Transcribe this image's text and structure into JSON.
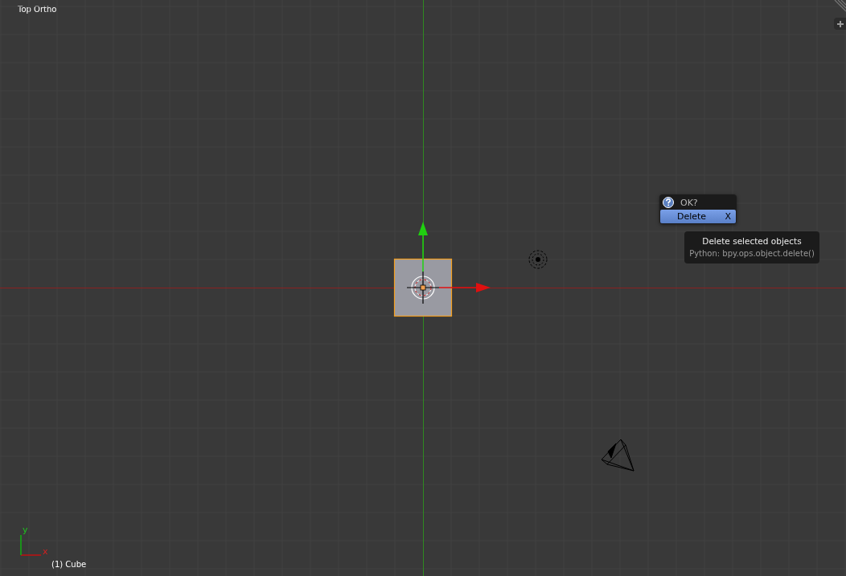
{
  "viewport": {
    "view_label": "Top Ortho",
    "object_label": "(1) Cube",
    "axis_labels": [
      "y",
      "x"
    ]
  },
  "cube": {
    "selected": true
  },
  "confirm_popup": {
    "title": "OK?",
    "items": [
      {
        "label": "Delete",
        "shortcut": "X",
        "selected": true
      }
    ]
  },
  "tooltip": {
    "title": "Delete selected objects",
    "python": "Python: bpy.ops.object.delete()"
  }
}
